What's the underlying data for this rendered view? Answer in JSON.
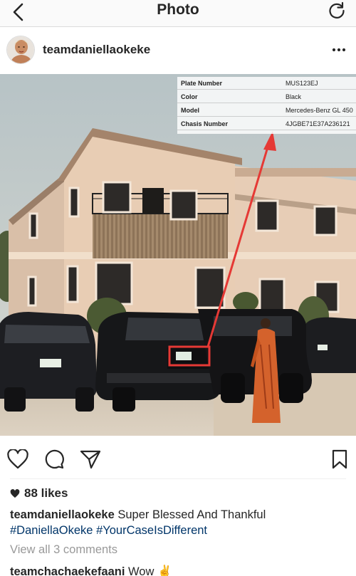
{
  "nav": {
    "title": "Photo",
    "back_icon": "chevron-left-icon",
    "refresh_icon": "refresh-icon"
  },
  "post": {
    "username": "teamdaniellaokeke",
    "more_icon": "more-options-icon"
  },
  "photo_overlay": {
    "rows": [
      {
        "label": "Plate Number",
        "value": "MUS123EJ"
      },
      {
        "label": "Color",
        "value": "Black"
      },
      {
        "label": "Model",
        "value": "Mercedes-Benz GL 450"
      },
      {
        "label": "Chasis Number",
        "value": "4JGBE71E37A236121"
      }
    ],
    "highlight_color": "#e53935"
  },
  "actions": {
    "like_icon": "heart-icon",
    "comment_icon": "comment-icon",
    "share_icon": "share-icon",
    "save_icon": "bookmark-icon"
  },
  "likes": {
    "text": "88 likes"
  },
  "caption": {
    "username": "teamdaniellaokeke",
    "text": "Super Blessed And Thankful",
    "hashtags": [
      "#DaniellaOkeke",
      "#YourCaseIsDifferent"
    ]
  },
  "comments": {
    "view_all": "View all 3 comments",
    "first": {
      "username": "teamchachaekefaani",
      "text": "Wow"
    }
  },
  "colors": {
    "link": "#003569",
    "muted": "#999999",
    "text": "#262626"
  }
}
